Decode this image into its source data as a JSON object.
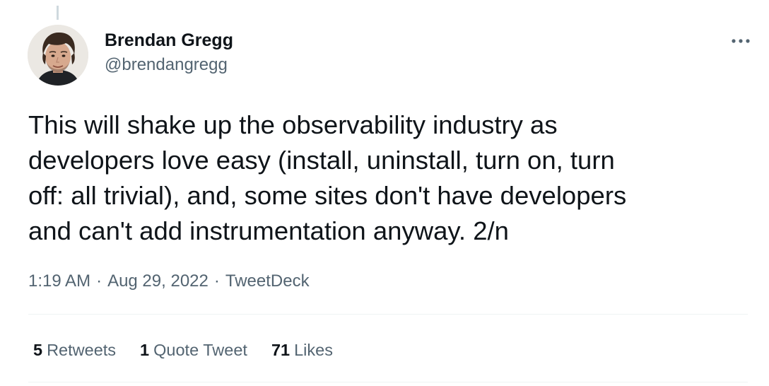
{
  "tweet": {
    "author": {
      "display_name": "Brendan Gregg",
      "handle": "@brendangregg"
    },
    "text": "This will shake up the observability industry as\ndevelopers love easy (install, uninstall, turn on, turn\noff: all trivial), and, some sites don't have developers\nand can't add instrumentation anyway. 2/n",
    "time": "1:19 AM",
    "date": "Aug 29, 2022",
    "source": "TweetDeck",
    "separator": "·",
    "stats": {
      "retweets": {
        "count": "5",
        "label": "Retweets"
      },
      "quote_tweets": {
        "count": "1",
        "label": "Quote Tweet"
      },
      "likes": {
        "count": "71",
        "label": "Likes"
      }
    }
  },
  "icons": {
    "more": "more-horizontal-icon"
  },
  "colors": {
    "text_primary": "#0f1419",
    "text_secondary": "#536471",
    "divider": "#eff3f4",
    "thread_line": "#cfd9de"
  }
}
